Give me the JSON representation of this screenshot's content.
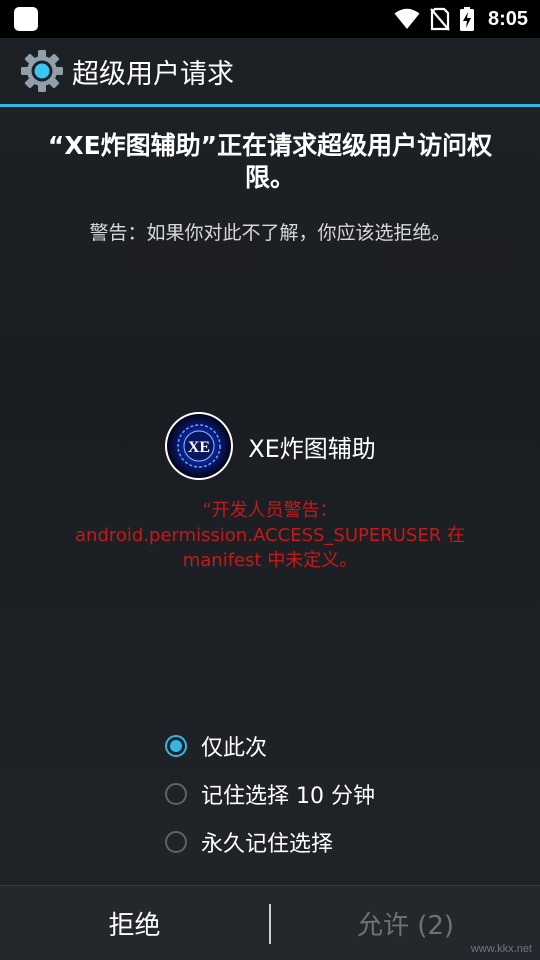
{
  "status_bar": {
    "time": "8:05",
    "icons": [
      "notification-icon",
      "wifi-icon",
      "no-sim-icon",
      "battery-charging-icon"
    ]
  },
  "action_bar": {
    "icon": "gear-icon",
    "title": "超级用户请求"
  },
  "request": {
    "title": "“XE炸图辅助”正在请求超级用户访问权限。",
    "warning": "警告：如果你对此不了解，你应该选拒绝。"
  },
  "app": {
    "icon": "xe-app-icon",
    "icon_text": "XE",
    "name": "XE炸图辅助",
    "developer_warning": "“开发人员警告：\nandroid.permission.ACCESS_SUPERUSER 在\nmanifest 中未定义。"
  },
  "options": [
    {
      "label": "仅此次",
      "checked": true
    },
    {
      "label": "记住选择 10 分钟",
      "checked": false
    },
    {
      "label": "永久记住选择",
      "checked": false
    }
  ],
  "buttons": {
    "deny": "拒绝",
    "allow": "允许 (2)"
  },
  "watermark": "www.kkx.net",
  "colors": {
    "accent": "#33b5e5",
    "warning_red": "#c51a1a",
    "background": "#1d2024"
  }
}
